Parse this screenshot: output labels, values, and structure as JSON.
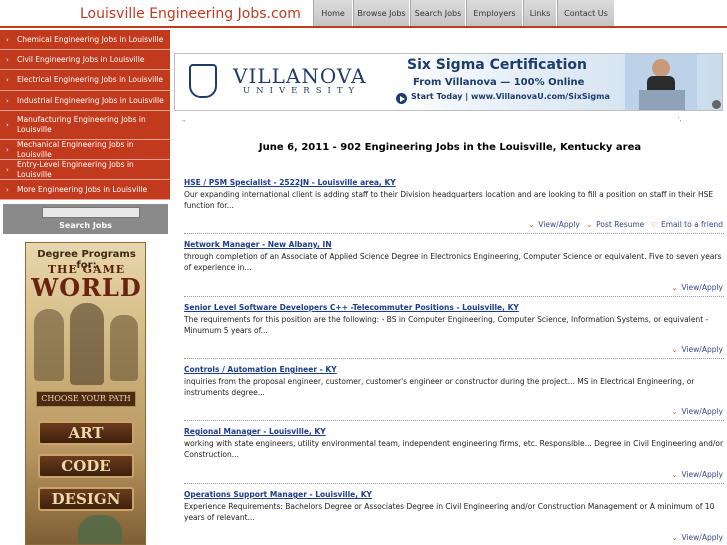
{
  "header": {
    "site_title": "Louisville Engineering Jobs.com",
    "nav": [
      "Home",
      "Browse Jobs",
      "Search Jobs",
      "Employers",
      "Links",
      "Contact Us"
    ]
  },
  "sidebar": {
    "items": [
      "Chemical Engineering Jobs in Louisville",
      "Civil Engineering Jobs in Louisville",
      "Electrical Engineering Jobs in Louisville",
      "Industrial Engineering Jobs in Louisville",
      "Manufacturing Engineering Jobs in Louisville",
      "Mechanical Engineering Jobs in Louisville",
      "Entry-Level Engineering Jobs in Louisville",
      "More Engineering Jobs in Louisville"
    ],
    "search_label": "Search Jobs",
    "search_value": "",
    "ad": {
      "top": "Degree Programs for:",
      "title_small": "THE GAME",
      "title_large": "WORLD",
      "choose": "CHOOSE YOUR PATH",
      "buttons": [
        "ART",
        "CODE",
        "DESIGN"
      ]
    }
  },
  "top_ad": {
    "university": "VILLANOVA",
    "university_sub": "UNIVERSITY",
    "headline": "Six Sigma Certification",
    "subline": "From Villanova — 100% Online",
    "cta": "Start Today  |  www.VillanovaU.com/SixSigma"
  },
  "main": {
    "heading": "June 6, 2011 - 902 Engineering Jobs in the Louisville, Kentucky area",
    "action_labels": {
      "view_apply": "View/Apply",
      "post_resume": "Post Resume",
      "email_friend": "Email to a friend"
    },
    "jobs": [
      {
        "title": "HSE / PSM Specialist - 2522JN - Louisville area, KY",
        "desc": "Our expanding international client is adding staff to their Division headquarters location and are looking to fill a position on staff in their HSE function for..."
      },
      {
        "title": "Network Manager - New Albany, IN",
        "desc": "through completion of an Associate of Applied Science Degree in Electronics Engineering, Computer Science or equivalent. Five to seven years of experience in..."
      },
      {
        "title": "Senior Level Software Developers C++ -Telecommuter Positions - Louisville, KY",
        "desc": "The requirements for this position are the following: - BS in Computer Engineering, Computer Science, Information Systems, or equivalent - Minumum 5 years of..."
      },
      {
        "title": "Controls / Automation Engineer - KY",
        "desc": "inquiries from the proposal engineer, customer, customer's engineer or constructor during the project... MS in Electrical Engineering, or instruments degree..."
      },
      {
        "title": "Regional Manager - Louisville, KY",
        "desc": "working with state engineers, utility environmental team, independent engineering firms, etc. Responsible... Degree in Civil Engineering and/or Construction..."
      },
      {
        "title": "Operations Support Manager - Louisville, KY",
        "desc": "Experience Requirements: Bachelors Degree or Associates Degree in Civil Engineering and/or Construction Management or A minimum of 10 years of relevant..."
      }
    ]
  },
  "colors": {
    "accent": "#c23a1e",
    "link": "#1d3c8c",
    "nav_bg": "#d0d0d0"
  }
}
